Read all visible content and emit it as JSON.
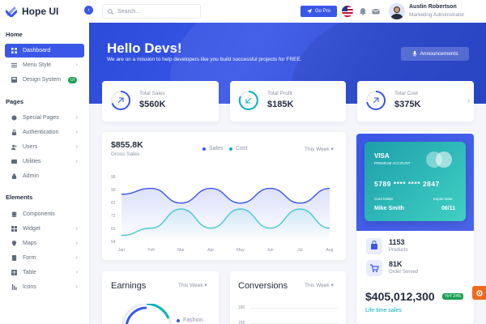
{
  "brand": {
    "name": "Hope UI"
  },
  "search": {
    "placeholder": "Search..."
  },
  "topbar": {
    "gopro_label": "Go Pro",
    "user_name": "Austin Robertson",
    "user_role": "Marketing Administrator"
  },
  "sidebar": {
    "sections": {
      "home": "Home",
      "pages": "Pages",
      "elements": "Elements"
    },
    "home_items": [
      {
        "label": "Dashboard",
        "icon": "grid-icon"
      },
      {
        "label": "Menu Style",
        "icon": "menu-icon"
      },
      {
        "label": "Design System",
        "icon": "layout-icon",
        "badge": "UI"
      }
    ],
    "page_items": [
      {
        "label": "Special Pages",
        "icon": "star-icon"
      },
      {
        "label": "Authentication",
        "icon": "lock-icon"
      },
      {
        "label": "Users",
        "icon": "users-icon"
      },
      {
        "label": "Utilities",
        "icon": "tool-icon"
      },
      {
        "label": "Admin",
        "icon": "admin-icon"
      }
    ],
    "element_items": [
      {
        "label": "Components",
        "icon": "components-icon"
      },
      {
        "label": "Widget",
        "icon": "widget-icon"
      },
      {
        "label": "Maps",
        "icon": "map-icon"
      },
      {
        "label": "Form",
        "icon": "form-icon"
      },
      {
        "label": "Table",
        "icon": "table-icon"
      },
      {
        "label": "Icons",
        "icon": "icons-icon"
      }
    ]
  },
  "hero": {
    "title": "Hello Devs!",
    "subtitle": "We are on a mission to help developers like you build successful projects for FREE.",
    "announce_label": "Announcements"
  },
  "stats": [
    {
      "label": "Total Sales",
      "value": "$560K",
      "color": "#3a57e8"
    },
    {
      "label": "Total Profit",
      "value": "$185K",
      "color": "#08b1ba"
    },
    {
      "label": "Total Cost",
      "value": "$375K",
      "color": "#3a57e8"
    }
  ],
  "gross": {
    "value": "$855.8K",
    "label": "Gross Sales",
    "legend_sales": "Sales",
    "legend_cost": "Cost",
    "period": "This Week"
  },
  "chart_data": {
    "type": "line",
    "categories": [
      "Jan",
      "Feb",
      "Mar",
      "Apr",
      "May",
      "Jun",
      "Jul",
      "Aug"
    ],
    "y_ticks": [
      "98",
      "90",
      "81",
      "72",
      "63",
      "54"
    ],
    "ylim": [
      54,
      98
    ],
    "series": [
      {
        "name": "Sales",
        "color": "#3a57e8",
        "values": [
          86,
          90,
          80,
          90,
          80,
          90,
          80,
          90
        ]
      },
      {
        "name": "Cost",
        "color": "#4bc7d2",
        "values": [
          58,
          63,
          76,
          63,
          76,
          63,
          76,
          63
        ]
      }
    ],
    "legend": "top"
  },
  "credit_card": {
    "brand": "VISA",
    "tier": "PREMIUM ACCOUNT",
    "number": "5789  ****  ****  2847",
    "holder_label": "Card holder",
    "holder": "Mike Smith",
    "expire_label": "Expire Date",
    "expire": "06/11"
  },
  "products": {
    "value": "1153",
    "label": "Products"
  },
  "orders": {
    "value": "81K",
    "label": "Order Served"
  },
  "lifetime": {
    "value": "$405,012,300",
    "badge": "YoY 24%",
    "label": "Life time sales"
  },
  "earnings": {
    "title": "Earnings",
    "period": "This Week",
    "legend": "Fashion"
  },
  "conversions": {
    "title": "Conversions",
    "period": "This Week",
    "ytick": "180",
    "ytick2": "150"
  }
}
